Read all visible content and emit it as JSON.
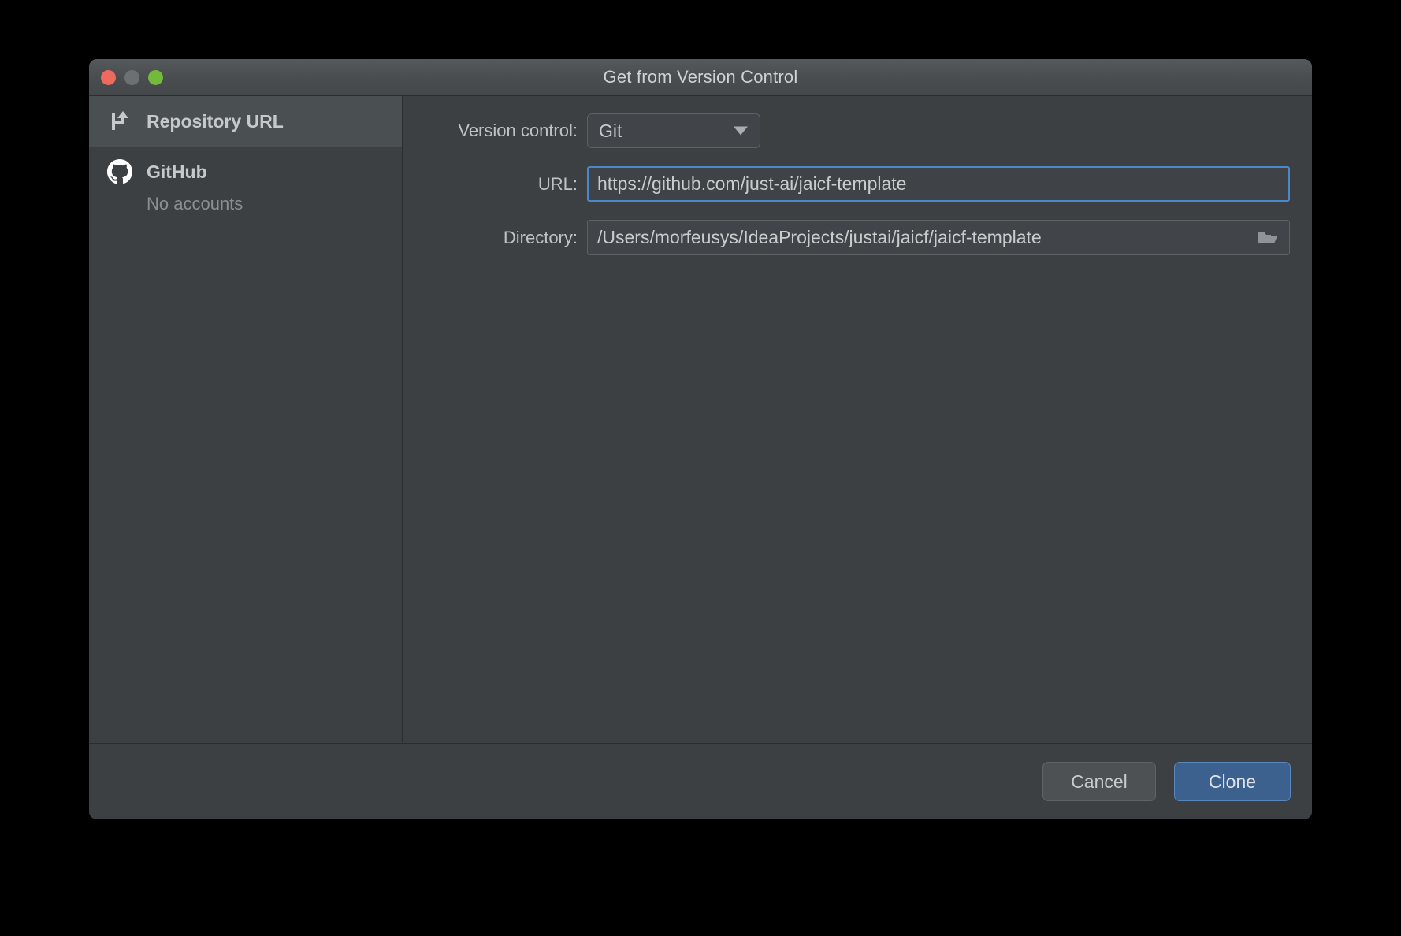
{
  "window": {
    "title": "Get from Version Control",
    "traffic_lights": [
      {
        "name": "close",
        "color": "#ec6a5e"
      },
      {
        "name": "minimize",
        "color": "#6d7072"
      },
      {
        "name": "zoom",
        "color": "#73b93a"
      }
    ]
  },
  "sidebar": {
    "items": [
      {
        "label": "Repository URL",
        "icon": "git-clone-icon",
        "selected": true
      },
      {
        "label": "GitHub",
        "icon": "github-icon",
        "selected": false,
        "sublabel": "No accounts"
      }
    ]
  },
  "form": {
    "version_control": {
      "label": "Version control:",
      "value": "Git",
      "options": [
        "Git"
      ],
      "arrow_icon": "chevron-down-icon"
    },
    "url": {
      "label": "URL:",
      "value": "https://github.com/just-ai/jaicf-template",
      "placeholder": "",
      "focused": true,
      "focus_color": "#4b88c7"
    },
    "directory": {
      "label": "Directory:",
      "value": "/Users/morfeusys/IdeaProjects/justai/jaicf/jaicf-template",
      "placeholder": "",
      "browse_icon": "folder-open-icon"
    }
  },
  "footer": {
    "cancel_label": "Cancel",
    "clone_label": "Clone",
    "primary_color": "#3c618f"
  }
}
